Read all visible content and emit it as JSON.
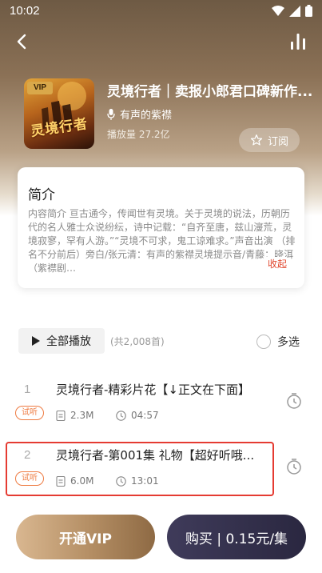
{
  "status": {
    "time": "10:02"
  },
  "album": {
    "cover_tag": "VIP",
    "cover_text": "灵境行者",
    "title": "灵境行者｜卖报小郎君口碑新作...",
    "author": "有声的紫襟",
    "plays": "播放量 27.2亿",
    "subscribe_label": "订阅"
  },
  "intro": {
    "heading": "简介",
    "body": "内容简介 亘古通今，传闻世有灵境。关于灵境的说法，历朝历代的名人雅士众说纷纭，诗中记载：“自齐至唐，兹山濅荒，灵境寂寥，罕有人游。”“灵境不可求，鬼工谅难求。”声音出演 （排名不分前后）旁白/张元清：有声的紫襟灵境提示音/青藤：晓洱（紫襟剧…",
    "collapse_label": "收起"
  },
  "list": {
    "play_all_label": "全部播放",
    "total": "(共2,008首)",
    "multi_select_label": "多选",
    "tracks": [
      {
        "num": "1",
        "trial": "试听",
        "title": "灵境行者-精彩片花【↓正文在下面】",
        "size": "2.3M",
        "duration": "04:57"
      },
      {
        "num": "2",
        "trial": "试听",
        "title": "灵境行者-第001集 礼物【超好听哦...",
        "size": "6.0M",
        "duration": "13:01"
      }
    ]
  },
  "bottom": {
    "vip_label": "开通VIP",
    "buy_label": "购买 | 0.15元/集"
  },
  "colors": {
    "accent_orange": "#ee7b42",
    "collapse_red": "#e0452c",
    "highlight_red": "#e53b32",
    "vip_gold": "#b38d63",
    "buy_dark": "#2a2740"
  }
}
